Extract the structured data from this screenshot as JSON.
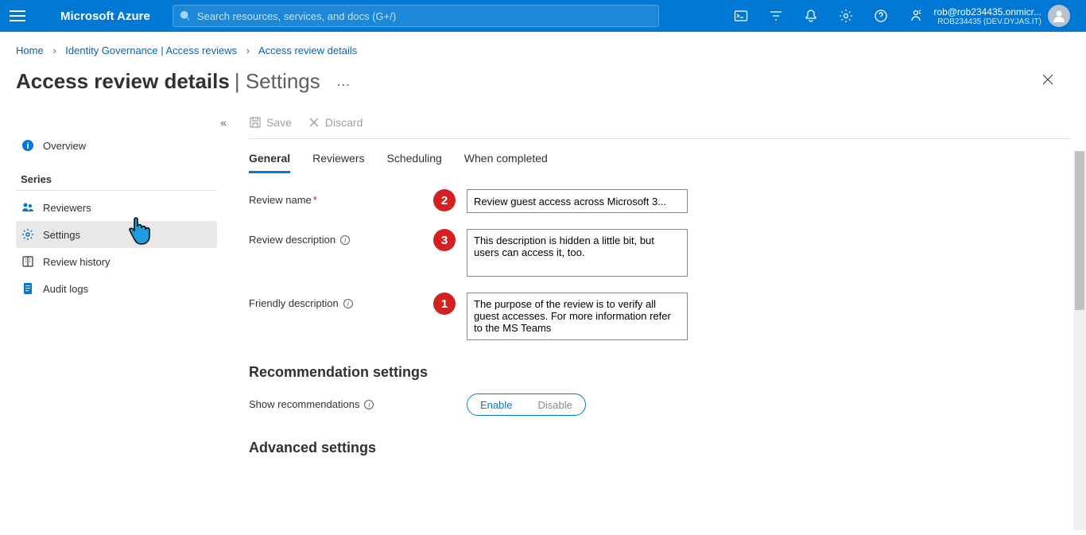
{
  "header": {
    "brand": "Microsoft Azure",
    "search_placeholder": "Search resources, services, and docs (G+/)",
    "user_email": "rob@rob234435.onmicr...",
    "user_tenant": "ROB234435 (DEV.DYJAS.IT)"
  },
  "breadcrumb": {
    "items": [
      {
        "label": "Home",
        "link": true
      },
      {
        "label": "Identity Governance | Access reviews",
        "link": true
      },
      {
        "label": "Access review details",
        "link": true
      }
    ]
  },
  "title": {
    "main": "Access review details",
    "sub": "| Settings"
  },
  "toolbar": {
    "save": "Save",
    "discard": "Discard"
  },
  "sidebar": {
    "overview": "Overview",
    "series_heading": "Series",
    "reviewers": "Reviewers",
    "settings": "Settings",
    "review_history": "Review history",
    "audit_logs": "Audit logs"
  },
  "tabs": {
    "general": "General",
    "reviewers": "Reviewers",
    "scheduling": "Scheduling",
    "when_completed": "When completed"
  },
  "form": {
    "review_name_label": "Review name",
    "review_name_value": "Review guest access across Microsoft 3...",
    "review_desc_label": "Review description",
    "review_desc_value": "This description is hidden a little bit, but users can access it, too.",
    "friendly_desc_label": "Friendly description",
    "friendly_desc_value": "The purpose of the review is to verify all guest accesses. For more information refer to the MS Teams",
    "badges": {
      "a": "2",
      "b": "3",
      "c": "1"
    }
  },
  "recommendation": {
    "heading": "Recommendation settings",
    "show_label": "Show recommendations",
    "enable": "Enable",
    "disable": "Disable"
  },
  "advanced": {
    "heading": "Advanced settings"
  }
}
